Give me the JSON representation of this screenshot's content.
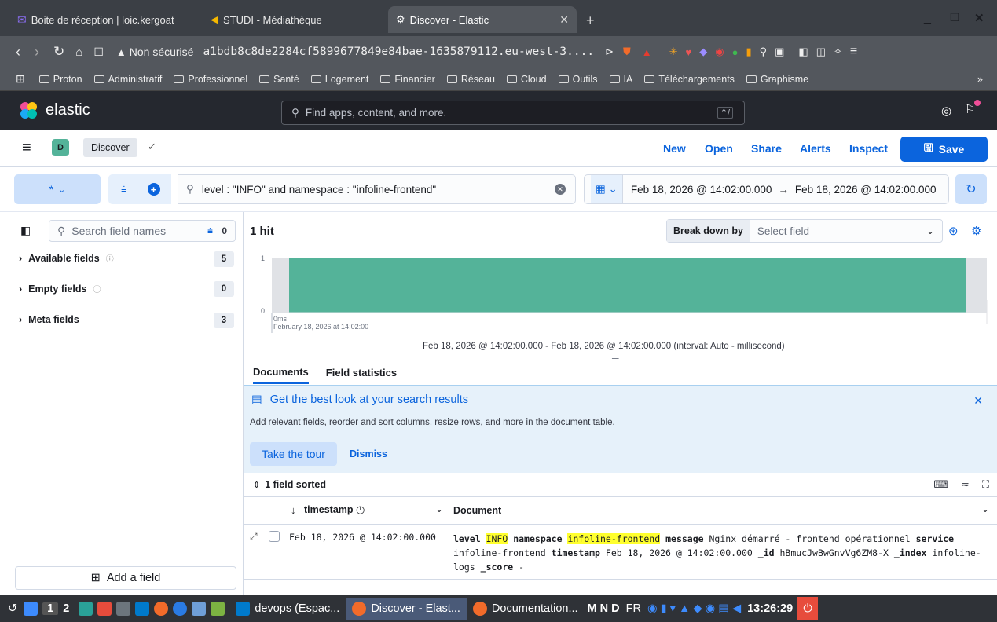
{
  "browser": {
    "tabs": [
      {
        "label": "Boite de réception | loic.kergoat",
        "active": false
      },
      {
        "label": "STUDI - Médiathèque",
        "active": false
      },
      {
        "label": "Discover - Elastic",
        "active": true
      }
    ],
    "security_label": "Non sécurisé",
    "url": "a1bdb8c8de2284cf5899677849e84bae-1635879112.eu-west-3....",
    "bookmarks": [
      "Proton",
      "Administratif",
      "Professionnel",
      "Santé",
      "Logement",
      "Financier",
      "Réseau",
      "Cloud",
      "Outils",
      "IA",
      "Téléchargements",
      "Graphisme"
    ],
    "bookmarks_more": "»"
  },
  "kibana": {
    "brand": "elastic",
    "global_search_placeholder": "Find apps, content, and more.",
    "global_search_shortcut": "⌃/",
    "space_letter": "D",
    "breadcrumb": "Discover",
    "nav": {
      "new": "New",
      "open": "Open",
      "share": "Share",
      "alerts": "Alerts",
      "inspect": "Inspect",
      "save": "Save"
    },
    "data_view": "*",
    "query": "level : \"INFO\" and namespace : \"infoline-frontend\"",
    "time_start": "Feb 18, 2026 @ 14:02:00.000",
    "time_arrow": "→",
    "time_end": "Feb 18, 2026 @ 14:02:00.000"
  },
  "sidebar": {
    "search_placeholder": "Search field names",
    "filter_count": "0",
    "groups": [
      {
        "label": "Available fields",
        "count": "5"
      },
      {
        "label": "Empty fields",
        "count": "0"
      },
      {
        "label": "Meta fields",
        "count": "3"
      }
    ],
    "add_field": "Add a field"
  },
  "results": {
    "hits": "1 hit",
    "breakdown_label": "Break down by",
    "breakdown_placeholder": "Select field",
    "chart_caption": "Feb 18, 2026 @ 14:02:00.000 - Feb 18, 2026 @ 14:02:00.000 (interval: Auto - millisecond)",
    "tabs": [
      "Documents",
      "Field statistics"
    ],
    "callout_title": "Get the best look at your search results",
    "callout_body": "Add relevant fields, reorder and sort columns, resize rows, and more in the document table.",
    "take_tour": "Take the tour",
    "dismiss": "Dismiss",
    "sorted_label": "1 field sorted",
    "col_timestamp": "timestamp",
    "col_document": "Document",
    "row": {
      "timestamp": "Feb 18, 2026 @ 14:02:00.000",
      "k_level": "level",
      "v_level": "INFO",
      "k_namespace": "namespace",
      "v_namespace": "infoline-frontend",
      "k_message": "message",
      "v_message": "Nginx démarré - frontend opérationnel",
      "k_service": "service",
      "v_service": "infoline-frontend",
      "k_timestamp": "timestamp",
      "v_timestamp": "Feb 18, 2026 @ 14:02:00.000",
      "k_id": "_id",
      "v_id": "hBmucJwBwGnvVg6ZM8-X",
      "k_index": "_index",
      "v_index": "infoline-logs",
      "k_score": "_score",
      "v_score": "-"
    }
  },
  "chart_data": {
    "type": "bar",
    "categories": [
      "0ms"
    ],
    "x_sublabel": "February 18, 2026 at 14:02:00",
    "values": [
      1
    ],
    "ylim": [
      0,
      1
    ],
    "y_ticks": [
      "1",
      "0"
    ],
    "bar_color": "#54b399"
  },
  "taskbar": {
    "workspaces": [
      "1",
      "2"
    ],
    "windows": [
      {
        "label": "devops (Espac...",
        "active": false
      },
      {
        "label": "Discover - Elast...",
        "active": true
      },
      {
        "label": "Documentation...",
        "active": false
      }
    ],
    "indicators": "M N D",
    "lang": "FR",
    "clock": "13:26:29"
  }
}
